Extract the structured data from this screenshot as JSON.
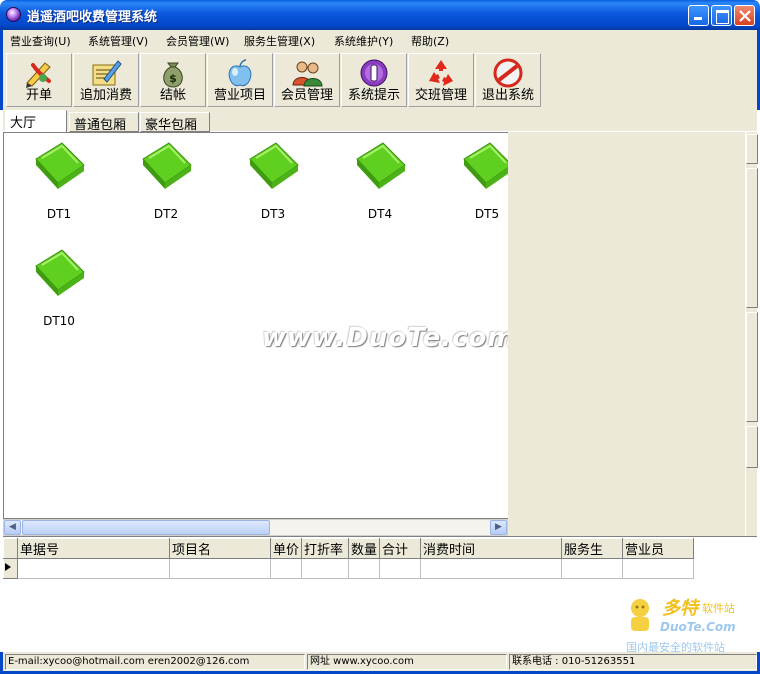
{
  "window": {
    "title": "逍遥酒吧收费管理系统"
  },
  "menu": [
    "营业查询(U)",
    "系统管理(V)",
    "会员管理(W)",
    "服务生管理(X)",
    "系统维护(Y)",
    "帮助(Z)"
  ],
  "toolbar": [
    {
      "label": "开单",
      "icon": "open-order-icon"
    },
    {
      "label": "追加消费",
      "icon": "add-consume-icon"
    },
    {
      "label": "结帐",
      "icon": "money-bag-icon"
    },
    {
      "label": "营业项目",
      "icon": "apple-icon"
    },
    {
      "label": "会员管理",
      "icon": "members-icon"
    },
    {
      "label": "系统提示",
      "icon": "system-tip-icon"
    },
    {
      "label": "交班管理",
      "icon": "recycle-icon"
    },
    {
      "label": "退出系统",
      "icon": "exit-icon"
    }
  ],
  "tabs": [
    "大厅",
    "普通包厢",
    "豪华包厢"
  ],
  "rooms": [
    "DT1",
    "DT2",
    "DT3",
    "DT4",
    "DT5",
    "DT10"
  ],
  "watermark": "www.DuoTe.com",
  "grid": {
    "columns": [
      "单据号",
      "项目名",
      "单价",
      "打折率",
      "数量",
      "合计",
      "消费时间",
      "服务生",
      "营业员"
    ],
    "rows": []
  },
  "status": {
    "email": "E-mail:xycoo@hotmail.com  eren2002@126.com",
    "website": "网址 www.xycoo.com",
    "phone": "联系电话 : 010-51263551"
  },
  "logo_watermark": {
    "line1": "多特",
    "line1b": "软件站",
    "line2": "DuoTe.Com",
    "line3": "国内最安全的软件站"
  },
  "colors": {
    "titlebar": "#0a5fe0",
    "chrome": "#ece9d8",
    "folder": "#6fd82a"
  }
}
